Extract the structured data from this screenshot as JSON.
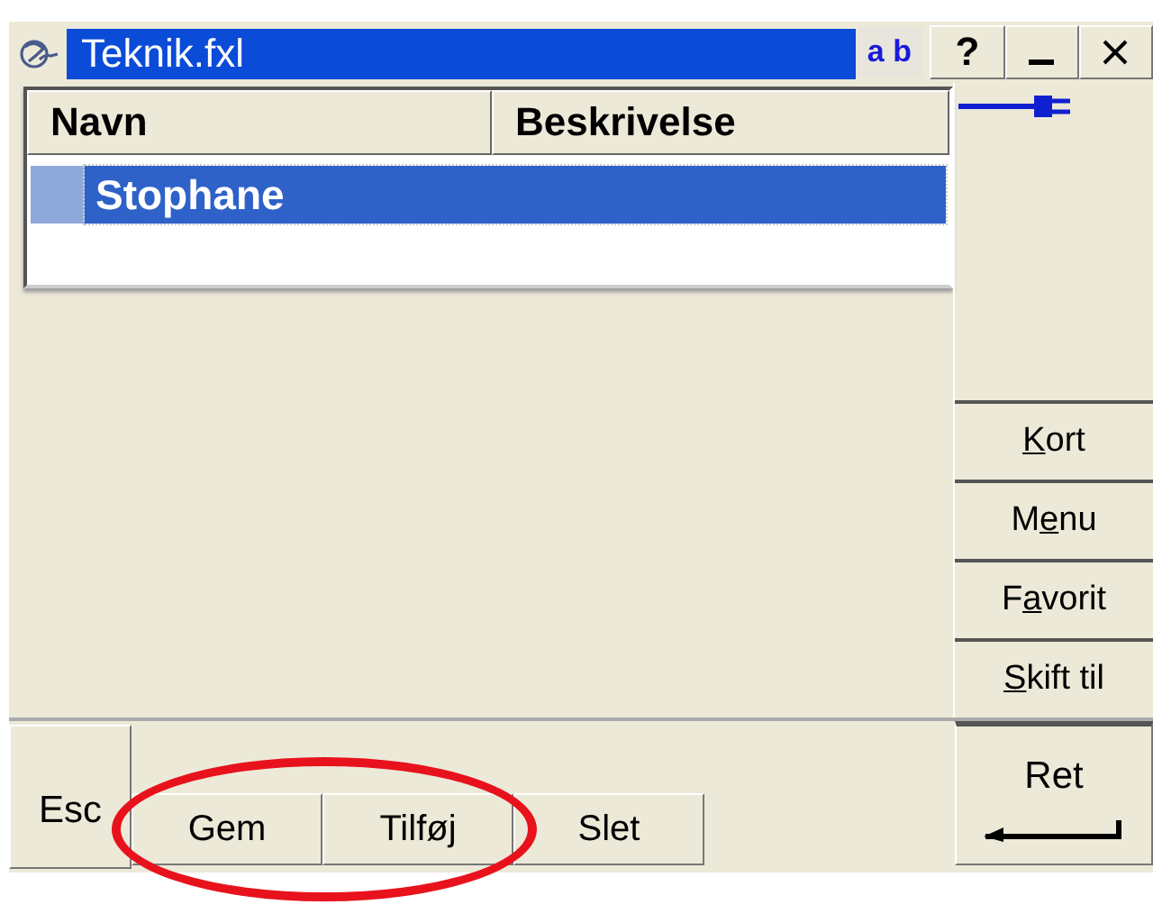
{
  "window": {
    "title": "Teknik.fxl",
    "input_mode": "a b",
    "buttons": [
      {
        "kind": "help",
        "label": "?"
      },
      {
        "kind": "minimize"
      },
      {
        "kind": "close"
      }
    ]
  },
  "table": {
    "columns": [
      "Navn",
      "Beskrivelse"
    ],
    "rows": [
      {
        "cells": [
          "Stophane"
        ],
        "selected": true
      }
    ]
  },
  "side_buttons": [
    {
      "mnemonic": "K",
      "after": "ort"
    },
    {
      "before": "M",
      "mnemonic": "e",
      "after": "nu"
    },
    {
      "before": "F",
      "mnemonic": "a",
      "after": "vorit"
    },
    {
      "mnemonic": "S",
      "after": "kift til"
    }
  ],
  "enter_button": {
    "label": "Ret"
  },
  "bottom_buttons": [
    {
      "kind": "esc",
      "label": "Esc"
    },
    {
      "kind": "normal",
      "label": "Gem"
    },
    {
      "kind": "normal",
      "label": "Tilføj"
    },
    {
      "kind": "normal",
      "label": "Slet"
    }
  ],
  "annotation": {
    "kind": "ellipse",
    "color": "#e8121c"
  }
}
